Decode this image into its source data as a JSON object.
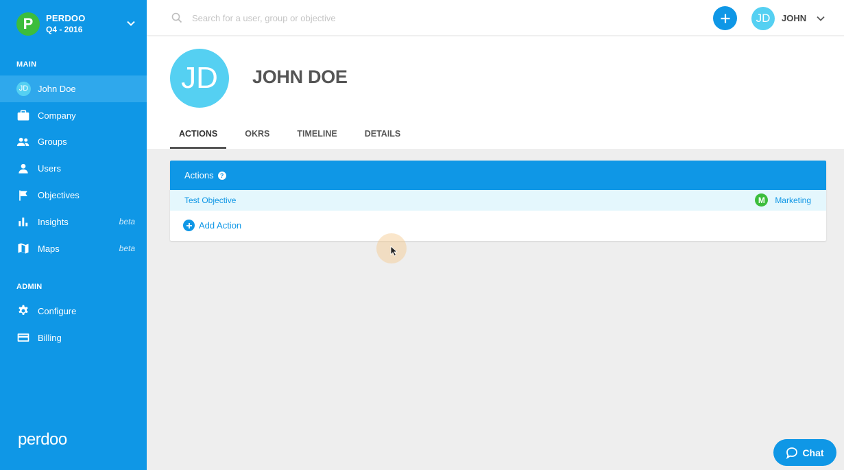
{
  "colors": {
    "primary": "#0f97e6",
    "sidebar_active": "#2fa8ec",
    "avatar": "#55d0f2",
    "org_green": "#3cbd3c",
    "row_highlight": "#e4f7fd"
  },
  "sidebar": {
    "org": {
      "logo_letter": "P",
      "name": "PERDOO",
      "period": "Q4 - 2016",
      "icon": "chevron-down-icon"
    },
    "main_label": "MAIN",
    "main_items": [
      {
        "label": "John Doe",
        "icon": "avatar",
        "avatar_text": "JD",
        "active": true
      },
      {
        "label": "Company",
        "icon": "briefcase-icon"
      },
      {
        "label": "Groups",
        "icon": "groups-icon"
      },
      {
        "label": "Users",
        "icon": "user-icon"
      },
      {
        "label": "Objectives",
        "icon": "flag-icon"
      },
      {
        "label": "Insights",
        "icon": "bar-chart-icon",
        "badge": "beta"
      },
      {
        "label": "Maps",
        "icon": "map-icon",
        "badge": "beta"
      }
    ],
    "admin_label": "ADMIN",
    "admin_items": [
      {
        "label": "Configure",
        "icon": "gear-icon"
      },
      {
        "label": "Billing",
        "icon": "credit-card-icon"
      }
    ],
    "brand": "perdoo"
  },
  "topbar": {
    "search_placeholder": "Search for a user, group or objective",
    "user_initials": "JD",
    "user_name": "JOHN"
  },
  "profile": {
    "initials": "JD",
    "name": "JOHN DOE",
    "tabs": [
      {
        "label": "ACTIONS",
        "active": true
      },
      {
        "label": "OKRS"
      },
      {
        "label": "TIMELINE"
      },
      {
        "label": "DETAILS"
      }
    ]
  },
  "actions_card": {
    "title": "Actions",
    "help_glyph": "?",
    "objective": "Test Objective",
    "team_letter": "M",
    "team_name": "Marketing",
    "add_label": "Add Action"
  },
  "chat": {
    "label": "Chat"
  }
}
